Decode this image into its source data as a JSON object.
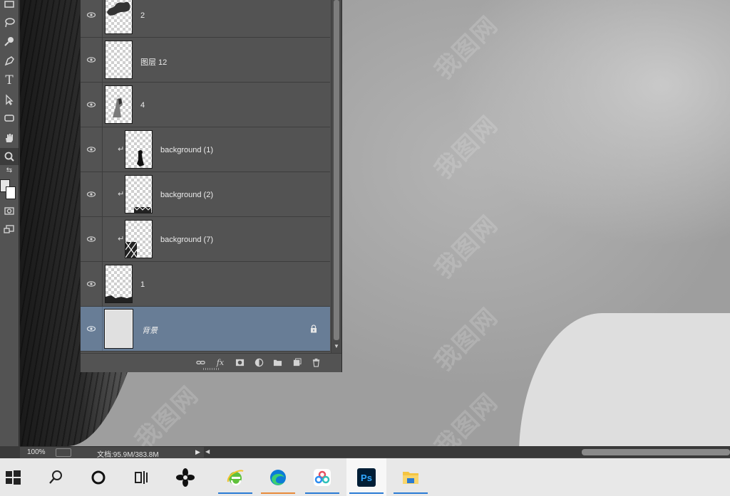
{
  "layers_panel": {
    "layers": [
      {
        "name": "2",
        "visible": true,
        "clipped": false,
        "thumb": "brush-strokes",
        "italic": false,
        "selected": false
      },
      {
        "name": "图层 12",
        "visible": true,
        "clipped": false,
        "thumb": "empty",
        "italic": false,
        "selected": false
      },
      {
        "name": "4",
        "visible": true,
        "clipped": false,
        "thumb": "figure",
        "italic": false,
        "selected": false
      },
      {
        "name": "background (1)",
        "visible": true,
        "clipped": true,
        "thumb": "small-figure",
        "italic": false,
        "selected": false
      },
      {
        "name": "background (2)",
        "visible": true,
        "clipped": true,
        "thumb": "bottom-pattern",
        "italic": false,
        "selected": false
      },
      {
        "name": "background (7)",
        "visible": true,
        "clipped": true,
        "thumb": "corner-pattern",
        "italic": false,
        "selected": false
      },
      {
        "name": "1",
        "visible": true,
        "clipped": false,
        "thumb": "bottom-dark",
        "italic": false,
        "selected": false
      },
      {
        "name": "背景",
        "visible": true,
        "clipped": false,
        "thumb": "plain",
        "italic": true,
        "selected": true,
        "locked": true
      }
    ],
    "footer_buttons": [
      "link-icon",
      "fx-icon",
      "mask-icon",
      "adjustment-icon",
      "folder-icon",
      "new-layer-icon",
      "trash-icon"
    ],
    "fx_label": "fx"
  },
  "status_bar": {
    "zoom": "100%",
    "doc_info": "文档:95.9M/383.8M"
  },
  "taskbar": {
    "items": [
      {
        "icon": "windows-start-icon"
      },
      {
        "icon": "search-icon"
      },
      {
        "icon": "cortana-icon"
      },
      {
        "icon": "task-view-icon"
      },
      {
        "icon": "pinwheel-app-icon"
      },
      {
        "icon": "ie-browser-icon"
      },
      {
        "icon": "edge-browser-icon"
      },
      {
        "icon": "baidu-netdisk-icon"
      },
      {
        "icon": "photoshop-icon",
        "label": "Ps"
      },
      {
        "icon": "file-explorer-icon"
      }
    ]
  },
  "watermark": "我图网",
  "colors": {
    "panel_bg": "#535353",
    "selected_layer": "#687d96",
    "taskbar_bg": "#e8e8e8",
    "photoshop_blue": "#31a8ff",
    "accent_underline": "#2a7bd4"
  }
}
